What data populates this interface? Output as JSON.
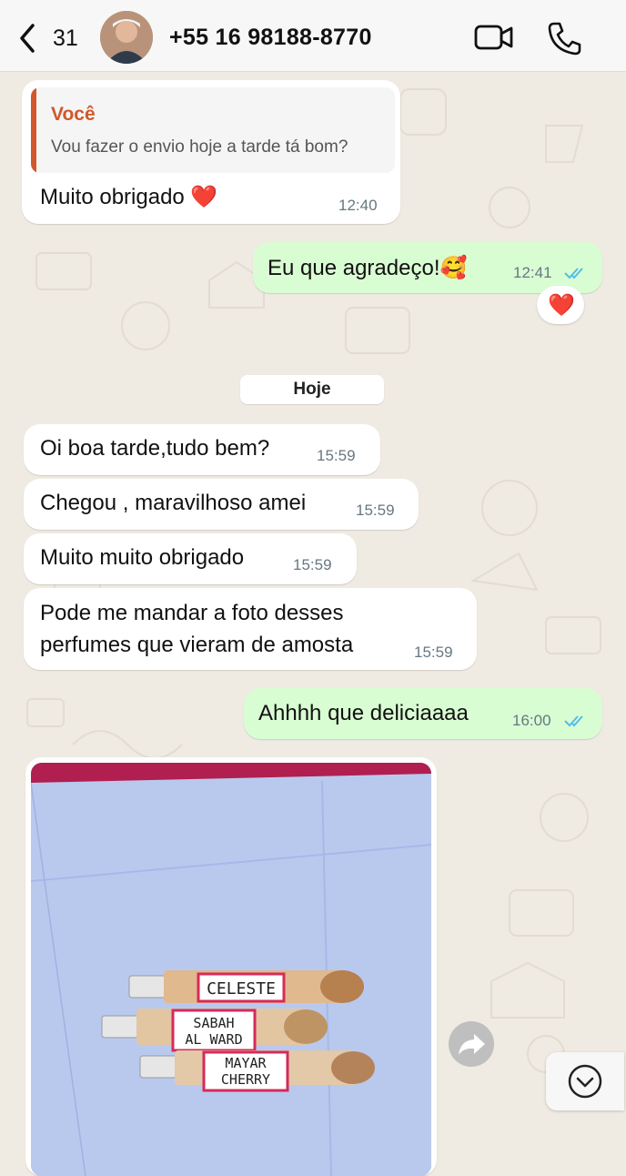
{
  "header": {
    "back_count": "31",
    "contact_name": "+55 16 98188-8770"
  },
  "date_divider": "Hoje",
  "messages": [
    {
      "direction": "incoming",
      "quote": {
        "author": "Você",
        "text": "Vou fazer o envio hoje a tarde tá bom?"
      },
      "text": "Muito obrigado ❤️",
      "time": "12:40"
    },
    {
      "direction": "outgoing",
      "text": "Eu que agradeço!🥰",
      "time": "12:41",
      "status": "read",
      "reaction": "❤️"
    },
    {
      "direction": "incoming",
      "text": "Oi boa tarde,tudo bem?",
      "time": "15:59"
    },
    {
      "direction": "incoming",
      "text": "Chegou , maravilhoso amei",
      "time": "15:59"
    },
    {
      "direction": "incoming",
      "text": "Muito muito obrigado",
      "time": "15:59"
    },
    {
      "direction": "incoming",
      "lines": [
        "Pode me mandar a foto desses",
        "perfumes que vieram de amosta"
      ],
      "time": "15:59"
    },
    {
      "direction": "outgoing",
      "text": "Ahhhh que deliciaaaa",
      "time": "16:00",
      "status": "read"
    },
    {
      "direction": "incoming",
      "type": "photo",
      "photo_labels": [
        "CELESTE",
        "SABAH",
        "AL WARD",
        "MAYAR",
        "CHERRY"
      ]
    }
  ],
  "icons": {
    "back": "chevron-left-icon",
    "video": "video-camera-icon",
    "call": "phone-icon",
    "read": "double-check-icon",
    "forward": "forward-arrow-icon",
    "scroll_down": "chevron-down-circle-icon"
  },
  "colors": {
    "outgoing_bubble": "#d9fdd3",
    "incoming_bubble": "#ffffff",
    "chat_background": "#efeae2",
    "quote_accent": "#d0582a",
    "read_ticks": "#53bdeb"
  }
}
